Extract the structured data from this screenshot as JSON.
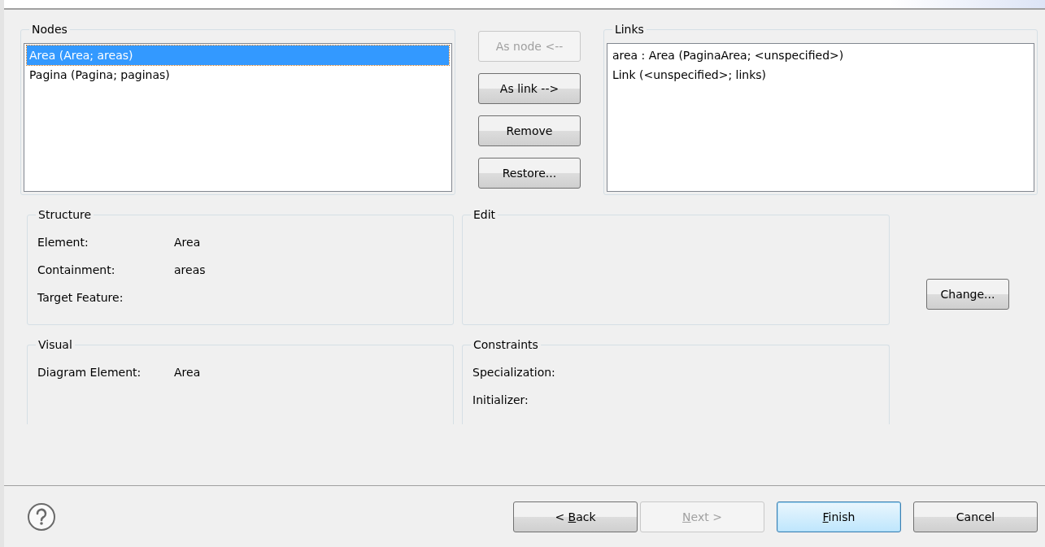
{
  "nodes": {
    "title": "Nodes",
    "items": [
      {
        "label": "Area (Area; areas)",
        "selected": true
      },
      {
        "label": "Pagina (Pagina; paginas)",
        "selected": false
      }
    ]
  },
  "move_buttons": [
    {
      "label": "As node <--",
      "disabled": true
    },
    {
      "label": "As link  -->",
      "disabled": false
    },
    {
      "label": "Remove",
      "disabled": false
    },
    {
      "label": "Restore...",
      "disabled": false
    }
  ],
  "links": {
    "title": "Links",
    "items": [
      {
        "label": "area : Area (PaginaArea; <unspecified>)",
        "selected": false
      },
      {
        "label": "Link (<unspecified>; links)",
        "selected": false
      }
    ]
  },
  "structure": {
    "title": "Structure",
    "fields": [
      {
        "label": "Element:",
        "value": "Area"
      },
      {
        "label": "Containment:",
        "value": "areas"
      },
      {
        "label": "Target Feature:"
      }
    ]
  },
  "edit": {
    "title": "Edit"
  },
  "change_button": "Change...",
  "visual": {
    "title": "Visual",
    "fields": [
      {
        "label": "Diagram Element:",
        "value": "Area"
      }
    ]
  },
  "constraints": {
    "title": "Constraints",
    "fields": [
      {
        "label": "Specialization:"
      },
      {
        "label": "Initializer:"
      }
    ]
  },
  "footer_buttons": [
    {
      "before": "< ",
      "mnemonic": "B",
      "after": "ack",
      "disabled": false,
      "default": false
    },
    {
      "mnemonic": "N",
      "after": "ext >",
      "disabled": true,
      "default": false
    },
    {
      "mnemonic": "F",
      "after": "inish",
      "disabled": false,
      "default": true
    },
    {
      "before": "Cancel",
      "disabled": false,
      "default": false
    }
  ]
}
